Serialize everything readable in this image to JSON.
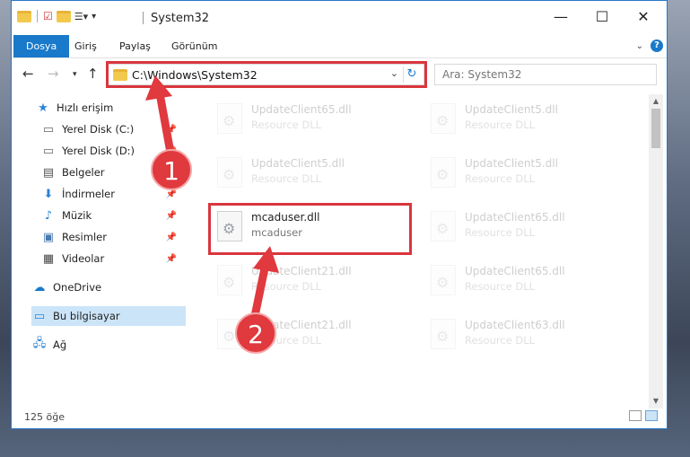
{
  "window": {
    "title": "System32",
    "controls": {
      "minimize": "—",
      "maximize": "☐",
      "close": "✕"
    }
  },
  "ribbon": {
    "tabs": [
      "Dosya",
      "Giriş",
      "Paylaş",
      "Görünüm"
    ],
    "help": "?"
  },
  "navigation": {
    "address": "C:\\Windows\\System32",
    "search_placeholder": "Ara: System32"
  },
  "sidebar": {
    "items": [
      {
        "label": "Hızlı erişim",
        "icon": "star-icon"
      },
      {
        "label": "Yerel Disk (C:)",
        "icon": "drive-icon",
        "pinned": true
      },
      {
        "label": "Yerel Disk (D:)",
        "icon": "drive-icon",
        "pinned": true
      },
      {
        "label": "Belgeler",
        "icon": "documents-icon",
        "pinned": true
      },
      {
        "label": "İndirmeler",
        "icon": "download-icon",
        "pinned": true
      },
      {
        "label": "Müzik",
        "icon": "music-icon",
        "pinned": true
      },
      {
        "label": "Resimler",
        "icon": "pictures-icon",
        "pinned": true
      },
      {
        "label": "Videolar",
        "icon": "video-icon",
        "pinned": true
      },
      {
        "label": "OneDrive",
        "icon": "cloud-icon"
      },
      {
        "label": "Bu bilgisayar",
        "icon": "computer-icon",
        "selected": true
      },
      {
        "label": "Ağ",
        "icon": "network-icon"
      }
    ]
  },
  "files": [
    {
      "name": "UpdateClient65.dll",
      "desc": "Resource DLL",
      "faded": true
    },
    {
      "name": "UpdateClient5.dll",
      "desc": "Resource DLL",
      "faded": true
    },
    {
      "name": "UpdateClient5.dll",
      "desc": "Resource DLL",
      "faded": true
    },
    {
      "name": "UpdateClient5.dll",
      "desc": "Resource DLL",
      "faded": true
    },
    {
      "name": "mcaduser.dll",
      "desc": "mcaduser",
      "faded": false
    },
    {
      "name": "UpdateClient65.dll",
      "desc": "Resource DLL",
      "faded": true
    },
    {
      "name": "UpdateClient21.dll",
      "desc": "Resource DLL",
      "faded": true
    },
    {
      "name": "UpdateClient65.dll",
      "desc": "Resource DLL",
      "faded": true
    },
    {
      "name": "UpdateClient21.dll",
      "desc": "Resource DLL",
      "faded": true
    },
    {
      "name": "UpdateClient63.dll",
      "desc": "Resource DLL",
      "faded": true
    }
  ],
  "status": {
    "item_count": "125 öğe"
  },
  "annotations": {
    "step1": "1",
    "step2": "2"
  },
  "colors": {
    "accent": "#1979ca",
    "highlight": "#d9363e"
  }
}
